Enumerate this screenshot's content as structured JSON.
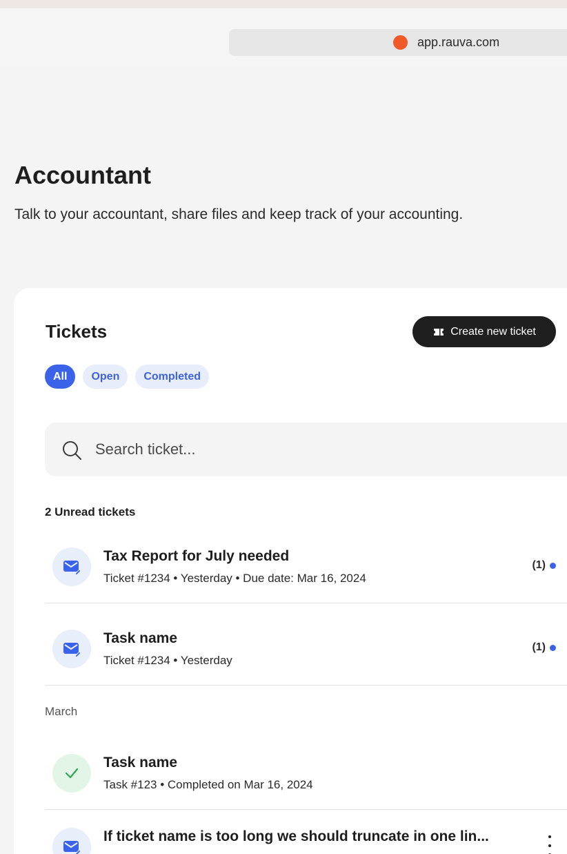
{
  "browser": {
    "url": "app.rauva.com",
    "favicon_color": "#f05a28"
  },
  "page": {
    "title": "Accountant",
    "subtitle": "Talk to your accountant, share files and keep track of your accounting."
  },
  "tickets_card": {
    "title": "Tickets",
    "create_button_label": "Create new ticket",
    "create_button_icon": "ticket-icon",
    "create_button_color": "#1f1f1f",
    "filters": [
      "All",
      "Open",
      "Completed"
    ],
    "active_filter": "All",
    "accent_color": "#3b63ea",
    "search_placeholder": "Search ticket...",
    "unread_section_label": "2 Unread tickets",
    "month_section_label": "March"
  },
  "tickets": [
    {
      "title": "Tax Report for July needed",
      "meta": "Ticket #1234 • Yesterday • Due date: Mar 16, 2024",
      "count": "(1)",
      "icon": "mail-edit-icon",
      "unread": true
    },
    {
      "title": "Task name",
      "meta": "Ticket #1234 • Yesterday",
      "count": "(1)",
      "icon": "mail-edit-icon",
      "unread": true
    },
    {
      "title": "Task name",
      "meta": "Task #123 • Completed on Mar 16, 2024",
      "icon": "checkmark-icon",
      "status_color": "#2fa84f"
    },
    {
      "title": "If ticket name is too long we should truncate in one lin...",
      "icon": "mail-edit-icon",
      "has_more_menu": true
    }
  ]
}
